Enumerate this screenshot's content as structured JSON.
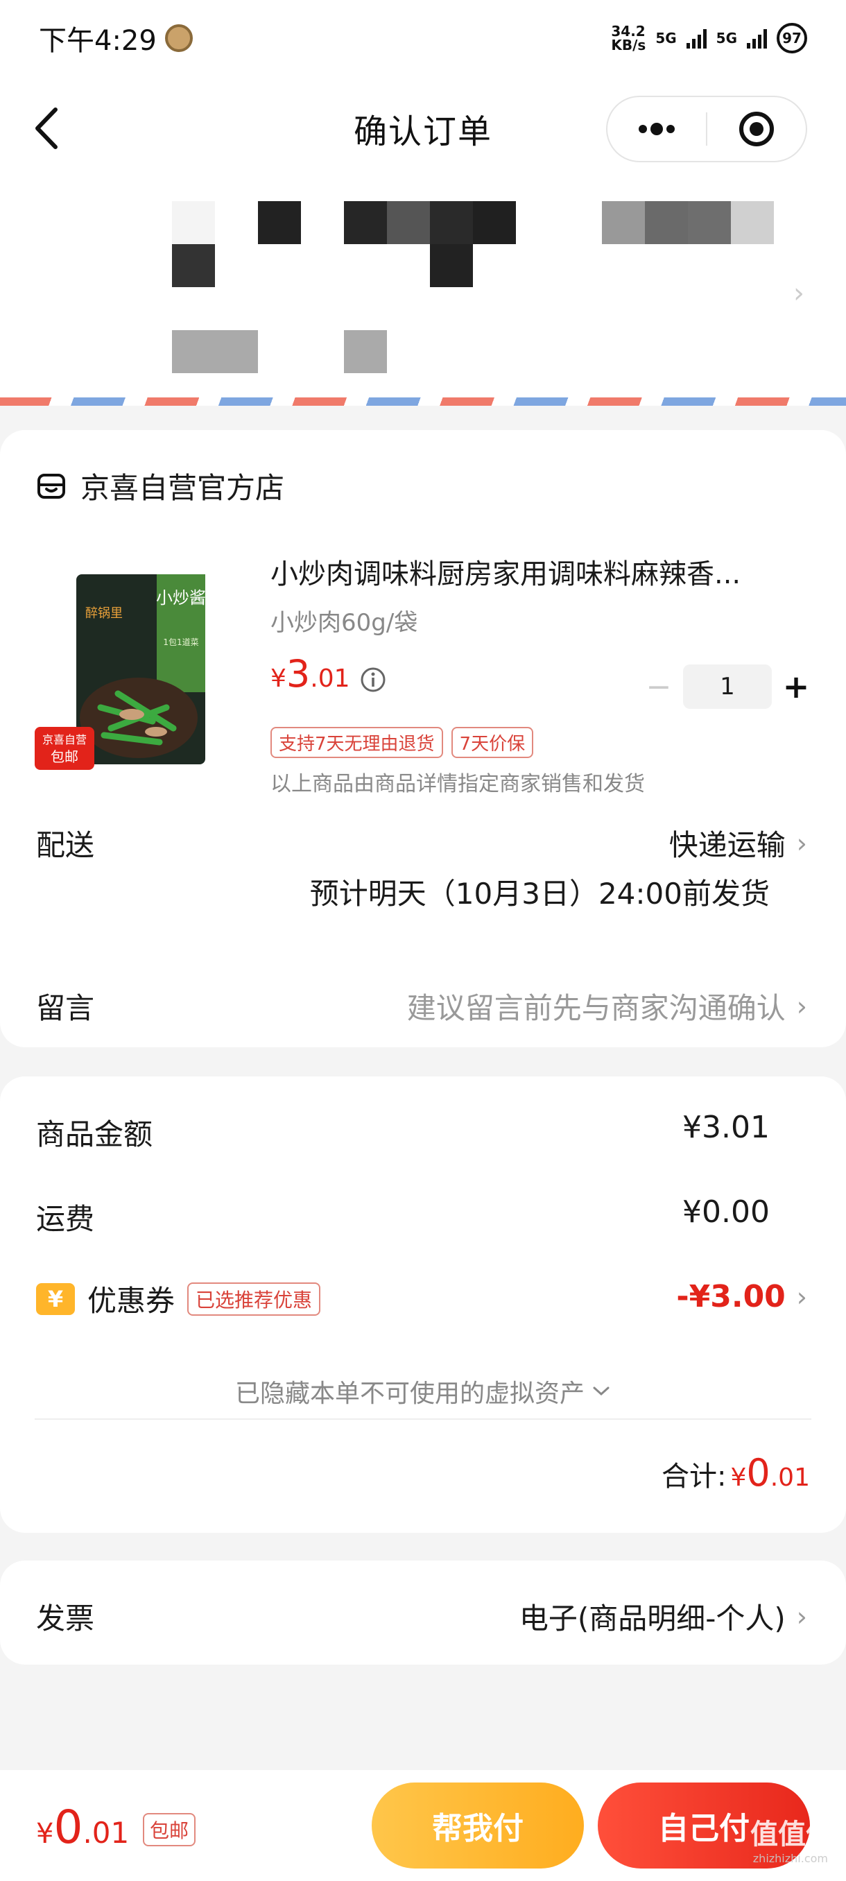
{
  "status_bar": {
    "time": "下午4:29",
    "net_speed_value": "34.2",
    "net_speed_unit": "KB/s",
    "network1": "5G",
    "network2": "5G",
    "battery": "97"
  },
  "nav": {
    "title": "确认订单"
  },
  "store": {
    "name": "京喜自营官方店",
    "product": {
      "title": "小炒肉调味料厨房家用调味料麻辣香...",
      "spec": "小炒肉60g/袋",
      "price_symbol": "¥",
      "price_int": "3",
      "price_dec": ".01",
      "quantity": "1",
      "tags": [
        "支持7天无理由退货",
        "7天价保"
      ],
      "seller_note": "以上商品由商品详情指定商家销售和发货",
      "image_badge_top": "京喜自营",
      "image_badge_bottom": "包邮",
      "image_brand": "醉锅里",
      "image_side_text": "小炒酱",
      "image_sub_text": "1包1道菜"
    },
    "delivery": {
      "label": "配送",
      "method": "快递运输",
      "estimate": "预计明天（10月3日）24:00前发货"
    },
    "message": {
      "label": "留言",
      "placeholder": "建议留言前先与商家沟通确认"
    }
  },
  "amounts": {
    "goods_label": "商品金额",
    "goods_value": "¥3.01",
    "shipping_label": "运费",
    "shipping_value": "¥0.00",
    "coupon_icon": "¥",
    "coupon_label": "优惠券",
    "coupon_tag": "已选推荐优惠",
    "coupon_value": "-¥3.00",
    "hidden_assets": "已隐藏本单不可使用的虚拟资产",
    "total_label": "合计:",
    "total_symbol": "¥",
    "total_int": "0",
    "total_dec": ".01"
  },
  "invoice": {
    "label": "发票",
    "value": "电子(商品明细-个人)"
  },
  "bottom_bar": {
    "price_symbol": "¥",
    "price_int": "0",
    "price_dec": ".01",
    "tag": "包邮",
    "help_pay": "帮我付",
    "self_pay": "自己付",
    "watermark": "值值值",
    "watermark_sub": "zhizhizhi.com"
  },
  "colors": {
    "accent_red": "#e2231a",
    "help_button": "#ffb52a",
    "self_button": "#ee3324"
  }
}
